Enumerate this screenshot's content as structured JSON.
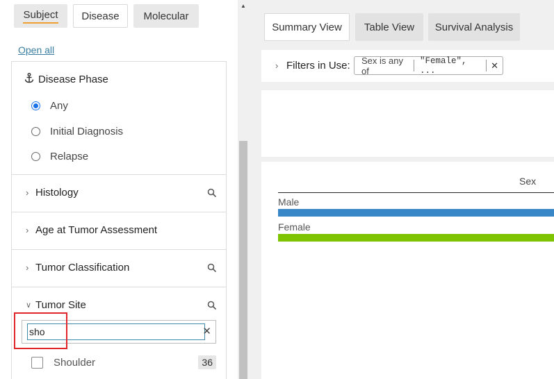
{
  "category_tabs": {
    "subject": "Subject",
    "disease": "Disease",
    "molecular": "Molecular"
  },
  "open_all": "Open all",
  "facets": {
    "disease_phase": {
      "title": "Disease Phase",
      "icon": "anchor-icon",
      "options": [
        {
          "label": "Any",
          "selected": true
        },
        {
          "label": "Initial Diagnosis",
          "selected": false
        },
        {
          "label": "Relapse",
          "selected": false
        }
      ]
    },
    "histology": {
      "title": "Histology"
    },
    "age": {
      "title": "Age at Tumor Assessment"
    },
    "classification": {
      "title": "Tumor Classification"
    },
    "tumor_site": {
      "title": "Tumor Site",
      "search_value": "sho",
      "results": [
        {
          "label": "Shoulder",
          "count": "36"
        }
      ]
    }
  },
  "view_tabs": {
    "summary": "Summary View",
    "table": "Table View",
    "survival": "Survival Analysis"
  },
  "filters": {
    "label": "Filters in Use:",
    "pill_field": "Sex is any of",
    "pill_value": "\"Female\", ..."
  },
  "colors": {
    "male_bar": "#3a87c8",
    "female_bar": "#7ec400",
    "highlight_box": "#e0252b",
    "link": "#3a7fa3"
  },
  "chart_data": {
    "type": "bar",
    "title": "Sex",
    "categories": [
      "Male",
      "Female"
    ]
  }
}
